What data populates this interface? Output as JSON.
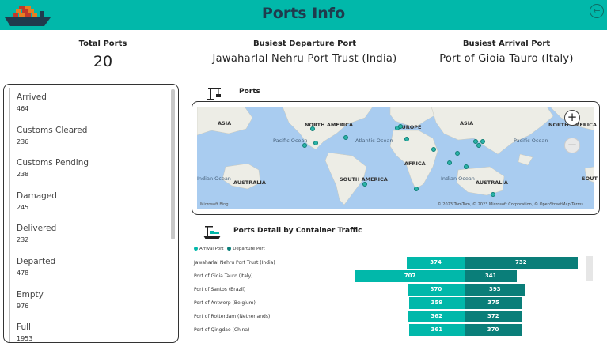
{
  "header": {
    "title": "Ports Info",
    "back_icon": "back-arrow-icon",
    "logo_icon": "cargo-ship-icon"
  },
  "kpis": [
    {
      "label": "Total Ports",
      "value": "20"
    },
    {
      "label": "Busiest Departure Port",
      "value": "Jawaharlal Nehru Port Trust (India)"
    },
    {
      "label": "Busiest Arrival Port",
      "value": "Port of Gioia Tauro (Italy)"
    }
  ],
  "statuses": [
    {
      "name": "Arrived",
      "count": "464"
    },
    {
      "name": "Customs Cleared",
      "count": "236"
    },
    {
      "name": "Customs Pending",
      "count": "238"
    },
    {
      "name": "Damaged",
      "count": "245"
    },
    {
      "name": "Delivered",
      "count": "232"
    },
    {
      "name": "Departed",
      "count": "478"
    },
    {
      "name": "Empty",
      "count": "976"
    },
    {
      "name": "Full",
      "count": "1953"
    }
  ],
  "map": {
    "title": "Ports",
    "continents": [
      "ASIA",
      "NORTH AMERICA",
      "EUROPE",
      "ASIA",
      "NORTH AMERICA",
      "AFRICA",
      "SOUTH AMERICA",
      "AUSTRALIA",
      "AUSTRALIA",
      "SOUT"
    ],
    "oceans": [
      "Pacific Ocean",
      "Atlantic Ocean",
      "Indian Ocean",
      "Pacific Ocean",
      "Indian Ocean"
    ],
    "attribution": "© 2023 TomTom, © 2023 Microsoft Corporation, © OpenStreetMap  Terms",
    "bing": "Microsoft Bing",
    "zoom_in": "+",
    "zoom_out": "−"
  },
  "chart_title": "Ports Detail by Container Traffic",
  "chart_data": {
    "type": "bar",
    "categories": [
      "Jawaharlal Nehru Port Trust (India)",
      "Port of Gioia Tauro (Italy)",
      "Port of Santos (Brazil)",
      "Port of Antwerp (Belgium)",
      "Port of Rotterdam (Netherlands)",
      "Port of Qingdao (China)"
    ],
    "series": [
      {
        "name": "Arrival Port",
        "values": [
          374,
          707,
          370,
          359,
          362,
          361
        ],
        "color": "#01B8AA"
      },
      {
        "name": "Departure Port",
        "values": [
          732,
          341,
          393,
          375,
          372,
          370
        ],
        "color": "#0A7E79"
      }
    ],
    "legend": "top-left"
  },
  "colors": {
    "header": "#01B8AA",
    "accent_dark": "#0A7E79",
    "map_water": "#A9CCF0",
    "map_land": "#EDEDE6"
  }
}
